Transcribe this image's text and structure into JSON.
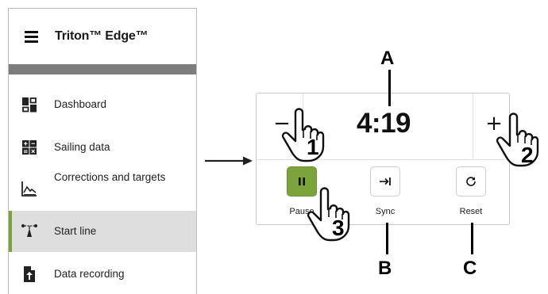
{
  "sidebar": {
    "app_title": "Triton™ Edge™",
    "items": [
      {
        "label": "Dashboard",
        "icon": "dashboard-icon"
      },
      {
        "label": "Sailing data",
        "icon": "sailing-data-icon"
      },
      {
        "label": "Corrections and targets",
        "icon": "corrections-targets-icon"
      },
      {
        "label": "Start line",
        "icon": "start-line-icon",
        "active": true
      },
      {
        "label": "Data recording",
        "icon": "data-recording-icon"
      }
    ]
  },
  "widget": {
    "timer": "4:19",
    "minus": "−",
    "plus": "+",
    "buttons": [
      {
        "label": "Pause",
        "icon": "pause-icon"
      },
      {
        "label": "Sync",
        "icon": "sync-icon"
      },
      {
        "label": "Reset",
        "icon": "reset-icon"
      }
    ]
  },
  "callouts": {
    "letters": {
      "a": "A",
      "b": "B",
      "c": "C"
    },
    "numbers": {
      "one": "1",
      "two": "2",
      "three": "3"
    }
  },
  "colors": {
    "accent": "#7da33c",
    "active_row": "#dedede",
    "band": "#7d7d7d"
  }
}
